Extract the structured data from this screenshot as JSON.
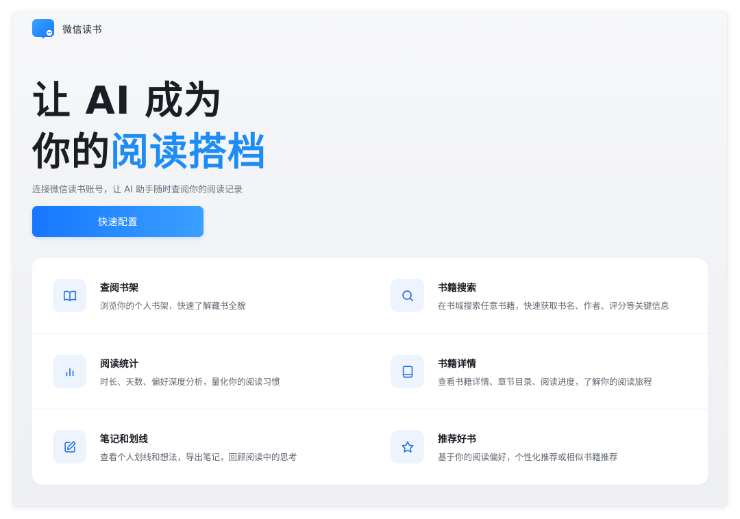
{
  "app": {
    "name": "微信读书",
    "logo_icon": "wechat-read-logo-icon"
  },
  "hero": {
    "line1": "让 AI 成为",
    "line2_plain": "你的",
    "line2_accent": "阅读搭档",
    "subtitle": "连接微信读书账号，让 AI 助手随时查阅你的阅读记录",
    "cta_label": "快速配置"
  },
  "colors": {
    "accent": "#1e8cf5",
    "button_start": "#1677ff",
    "button_end": "#3aa0ff",
    "icon_bg": "#eef4fd"
  },
  "features": [
    {
      "title": "查阅书架",
      "desc": "浏览你的个人书架，快速了解藏书全貌",
      "icon": "open-book-icon"
    },
    {
      "title": "书籍搜索",
      "desc": "在书城搜索任意书籍，快速获取书名、作者、评分等关键信息",
      "icon": "search-icon"
    },
    {
      "title": "阅读统计",
      "desc": "时长、天数、偏好深度分析，量化你的阅读习惯",
      "icon": "bar-chart-icon"
    },
    {
      "title": "书籍详情",
      "desc": "查看书籍详情、章节目录、阅读进度，了解你的阅读旅程",
      "icon": "book-icon"
    },
    {
      "title": "笔记和划线",
      "desc": "查看个人划线和想法，导出笔记，回顾阅读中的思考",
      "icon": "edit-note-icon"
    },
    {
      "title": "推荐好书",
      "desc": "基于你的阅读偏好，个性化推荐或相似书籍推荐",
      "icon": "star-icon"
    }
  ]
}
